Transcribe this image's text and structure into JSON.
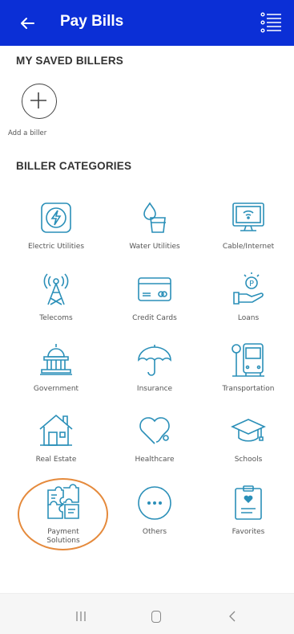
{
  "header": {
    "title": "Pay Bills",
    "bg": "#0b2fd6"
  },
  "saved": {
    "heading": "MY SAVED BILLERS",
    "add_label": "Add a biller"
  },
  "categories": {
    "heading": "BILLER CATEGORIES",
    "items": [
      {
        "label": "Electric Utilities",
        "icon": "lightning-icon"
      },
      {
        "label": "Water Utilities",
        "icon": "water-drop-icon"
      },
      {
        "label": "Cable/Internet",
        "icon": "tv-wifi-icon"
      },
      {
        "label": "Telecoms",
        "icon": "cell-tower-icon"
      },
      {
        "label": "Credit Cards",
        "icon": "credit-card-icon"
      },
      {
        "label": "Loans",
        "icon": "loan-hand-icon"
      },
      {
        "label": "Government",
        "icon": "capitol-building-icon"
      },
      {
        "label": "Insurance",
        "icon": "umbrella-icon"
      },
      {
        "label": "Transportation",
        "icon": "bus-stop-icon"
      },
      {
        "label": "Real Estate",
        "icon": "house-icon"
      },
      {
        "label": "Healthcare",
        "icon": "heart-stethoscope-icon"
      },
      {
        "label": "Schools",
        "icon": "graduation-cap-icon"
      },
      {
        "label": "Payment Solutions",
        "icon": "puzzle-icon"
      },
      {
        "label": "Others",
        "icon": "more-dots-icon"
      },
      {
        "label": "Favorites",
        "icon": "heart-clipboard-icon"
      }
    ]
  },
  "accent": "#2a8fb8",
  "highlight_color": "#e58a3c"
}
